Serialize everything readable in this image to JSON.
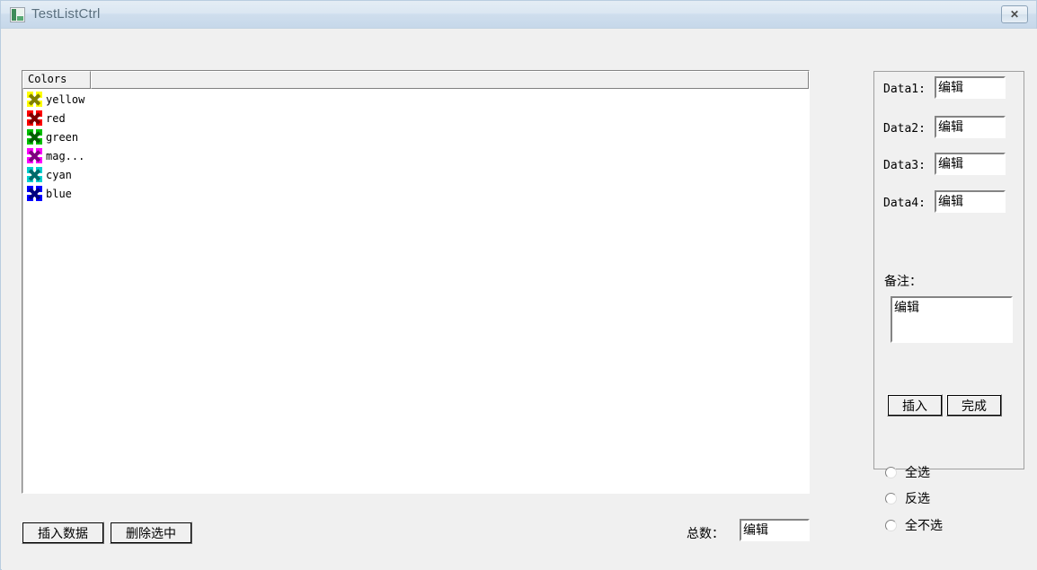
{
  "window": {
    "title": "TestListCtrl",
    "icon": "app-window-icon",
    "close_label": "✕"
  },
  "list": {
    "columns": [
      "Colors",
      ""
    ],
    "rows": [
      {
        "label": "yellow",
        "bright": "#ffff00",
        "dark": "#808000"
      },
      {
        "label": "red",
        "bright": "#ff0000",
        "dark": "#800000"
      },
      {
        "label": "green",
        "bright": "#00c000",
        "dark": "#006000"
      },
      {
        "label": "mag...",
        "bright": "#ff00ff",
        "dark": "#800080"
      },
      {
        "label": "cyan",
        "bright": "#00d0d0",
        "dark": "#006a6a"
      },
      {
        "label": "blue",
        "bright": "#0000ff",
        "dark": "#000080"
      }
    ]
  },
  "bottom": {
    "insert_data_label": "插入数据",
    "delete_selected_label": "删除选中",
    "total_label": "总数：",
    "total_value": "编辑"
  },
  "panel": {
    "fields": [
      {
        "label": "Data1:",
        "value": "编辑"
      },
      {
        "label": "Data2:",
        "value": "编辑"
      },
      {
        "label": "Data3:",
        "value": "编辑"
      },
      {
        "label": "Data4:",
        "value": "编辑"
      }
    ],
    "remark_label": "备注：",
    "remark_value": "编辑",
    "insert_label": "插入",
    "complete_label": "完成"
  },
  "radios": [
    {
      "label": "全选",
      "selected": false
    },
    {
      "label": "反选",
      "selected": false
    },
    {
      "label": "全不选",
      "selected": false
    }
  ]
}
